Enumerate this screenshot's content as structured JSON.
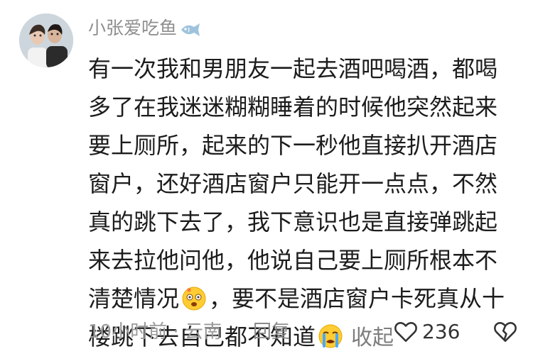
{
  "comment": {
    "username": "小张爱吃鱼",
    "text_part1": "有一次我和男朋友一起去酒吧喝酒，都喝多了在我迷迷糊糊睡着的时候他突然起来要上厕所，起来的下一秒他直接扒开酒店窗户，还好酒店窗户只能开一点点，不然真的跳下去了，我下意识也是直接弹跳起来去拉他问他，他说自己要上厕所根本不清楚情况",
    "text_part2": "，要不是酒店窗户卡死真从十楼跳下去自己都不知道",
    "collapse_label": "收起",
    "meta": "10小时前 · 云南",
    "reply_label": "回复",
    "like_count": "236",
    "icons": {
      "username_badge": "fish-icon",
      "emoji1": "dizzy-face-emoji",
      "emoji2": "crying-face-emoji",
      "like": "heart-outline-icon",
      "dislike": "broken-heart-icon"
    },
    "colors": {
      "username": "#8f8f8f",
      "text": "#1c1c1c",
      "meta": "#9a9a9a"
    }
  }
}
